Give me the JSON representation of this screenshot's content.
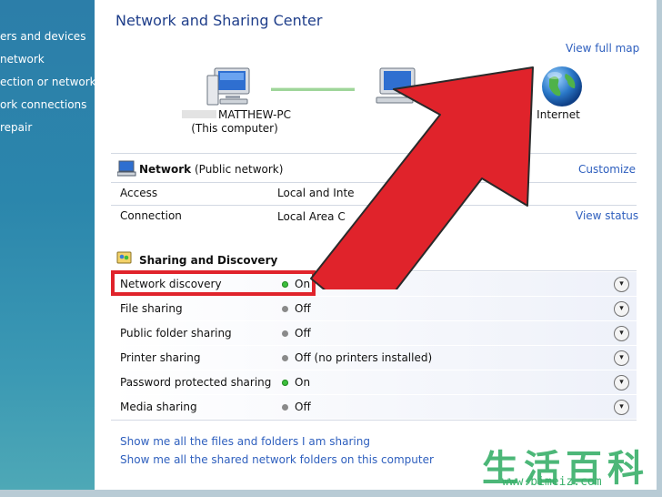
{
  "left_pane": {
    "items": [
      "ers and devices",
      "network",
      "ection or network",
      "ork connections",
      "repair"
    ]
  },
  "header": {
    "title": "Network and Sharing Center",
    "view_full_map": "View full map"
  },
  "map": {
    "computer_name": "MATTHEW-PC",
    "computer_sub": "(This computer)",
    "internet": "Internet"
  },
  "network": {
    "name": "Network",
    "type": "(Public network)",
    "customize": "Customize",
    "rows": [
      {
        "label": "Access",
        "value": "Local and Inte"
      },
      {
        "label": "Connection",
        "value": "Local Area C",
        "link": "View status"
      }
    ]
  },
  "sharing": {
    "title": "Sharing and Discovery",
    "rows": [
      {
        "label": "Network discovery",
        "value": "On",
        "state": "on"
      },
      {
        "label": "File sharing",
        "value": "Off",
        "state": "off"
      },
      {
        "label": "Public folder sharing",
        "value": "Off",
        "state": "off"
      },
      {
        "label": "Printer sharing",
        "value": "Off (no printers installed)",
        "state": "off"
      },
      {
        "label": "Password protected sharing",
        "value": "On",
        "state": "on"
      },
      {
        "label": "Media sharing",
        "value": "Off",
        "state": "off"
      }
    ]
  },
  "footer_links": [
    "Show me all the files and folders I am sharing",
    "Show me all the shared network folders on this computer"
  ],
  "watermark": {
    "chinese": "生活百科",
    "url": "www.bimeiz.com"
  },
  "colors": {
    "arrow": "#e0232b",
    "title_blue": "#1f3e8a",
    "link_blue": "#2e5fbe"
  }
}
